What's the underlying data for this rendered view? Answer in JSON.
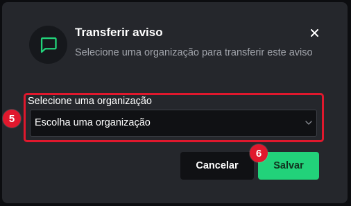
{
  "dialog": {
    "title": "Transferir aviso",
    "subtitle": "Selecione uma organização para transferir este aviso",
    "icon": "message-square-icon",
    "close_icon": "close-icon"
  },
  "form": {
    "label": "Selecione uma organização",
    "select_value": "Escolha uma organização",
    "chevron_icon": "chevron-down-icon"
  },
  "actions": {
    "cancel_label": "Cancelar",
    "save_label": "Salvar"
  },
  "annotations": {
    "step_5": "5",
    "step_6": "6"
  },
  "colors": {
    "accent_green": "#22d27a",
    "highlight_red": "#e0182d",
    "dialog_bg": "#25272c"
  }
}
